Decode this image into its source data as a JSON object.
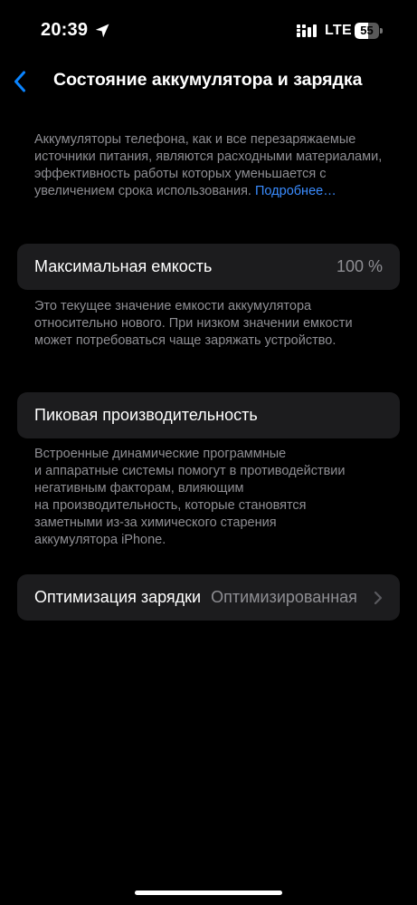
{
  "status_bar": {
    "time": "20:39",
    "network": "LTE",
    "battery_level": 55,
    "battery_text": "55",
    "icons": [
      "location-arrow-icon",
      "cellular-signal-icon",
      "battery-icon"
    ]
  },
  "nav": {
    "back_icon": "chevron-left-icon",
    "title": "Состояние аккумулятора и зарядка"
  },
  "intro": {
    "text": "Аккумуляторы телефона, как и все перезаряжаемые источники питания, являются расходными материалами, эффективность работы которых уменьшается с увеличением срока использования.",
    "link": "Подробнее…"
  },
  "max_capacity": {
    "label": "Максимальная емкость",
    "value": "100 %",
    "footer": "Это текущее значение емкости аккумулятора относительно нового. При низком значении емкости может потребоваться чаще заряжать устройство."
  },
  "peak_performance": {
    "label": "Пиковая производительность",
    "footer_lines": [
      "Встроенные динамические программные",
      "и аппаратные системы помогут в противодействии",
      "негативным факторам, влияющим",
      "на производительность, которые становятся",
      "заметными из-за химического старения",
      "аккумулятора iPhone."
    ]
  },
  "charging_optimization": {
    "label": "Оптимизация зарядки",
    "value": "Оптимизированная",
    "chevron_icon": "chevron-right-icon"
  },
  "colors": {
    "background": "#000000",
    "cell_background": "#1c1c1e",
    "secondary_text": "#8e8e93",
    "link": "#3a8cff",
    "accent": "#0a84ff"
  }
}
